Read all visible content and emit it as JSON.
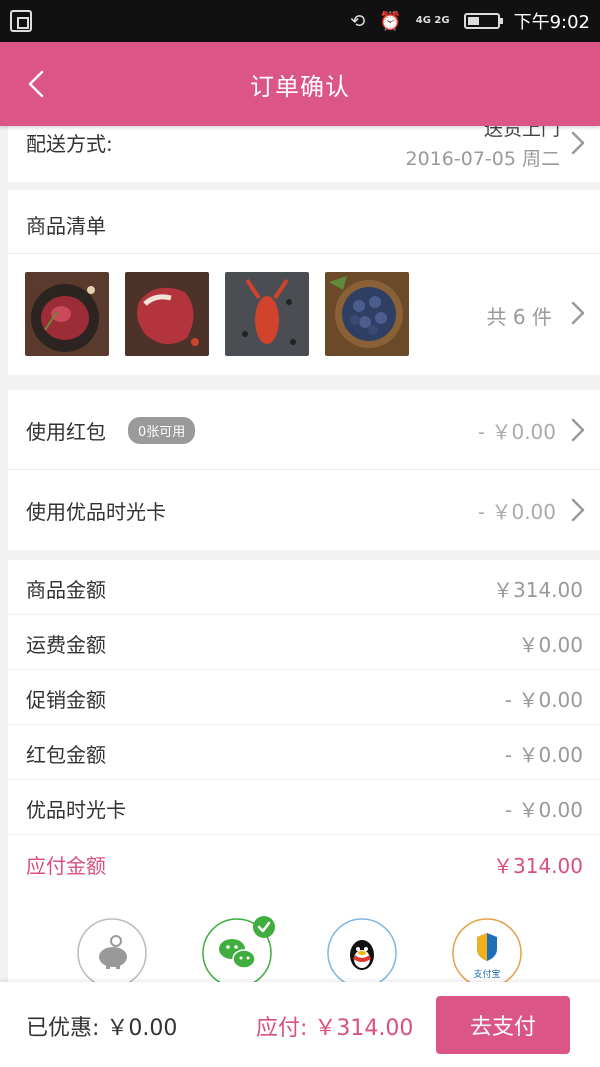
{
  "status_bar": {
    "network": "4G 2G",
    "time": "下午9:02",
    "battery_level": 0.35
  },
  "header": {
    "title": "订单确认"
  },
  "delivery": {
    "label": "配送方式:",
    "method": "送货上门",
    "date": "2016-07-05 周二"
  },
  "goods": {
    "title": "商品清单",
    "items": [
      "beef-steak-image",
      "sirloin-steak-image",
      "crayfish-image",
      "blueberries-image"
    ],
    "count_label": "共 6 件"
  },
  "coupons": {
    "redpack_label": "使用红包",
    "redpack_badge": "0张可用",
    "redpack_value": "- ￥0.00",
    "card_label": "使用优品时光卡",
    "card_value": "- ￥0.00"
  },
  "summary": {
    "rows": [
      {
        "label": "商品金额",
        "value": "￥314.00"
      },
      {
        "label": "运费金额",
        "value": "￥0.00"
      },
      {
        "label": "促销金额",
        "value": "- ￥0.00"
      },
      {
        "label": "红包金额",
        "value": "- ￥0.00"
      },
      {
        "label": "优品时光卡",
        "value": "- ￥0.00"
      },
      {
        "label": "应付金额",
        "value": "￥314.00"
      }
    ]
  },
  "payment_methods": {
    "options": [
      "piggy-bank-icon",
      "wechat-icon",
      "qq-icon",
      "alipay-icon"
    ],
    "alipay_text": "支付宝",
    "selected": "wechat-icon"
  },
  "bottom_bar": {
    "discount": "已优惠: ￥0.00",
    "due": "应付: ￥314.00",
    "pay_button": "去支付"
  },
  "colors": {
    "brand": "#db5587",
    "accent_text": "#d94f83",
    "wechat_green": "#3fae3f"
  }
}
